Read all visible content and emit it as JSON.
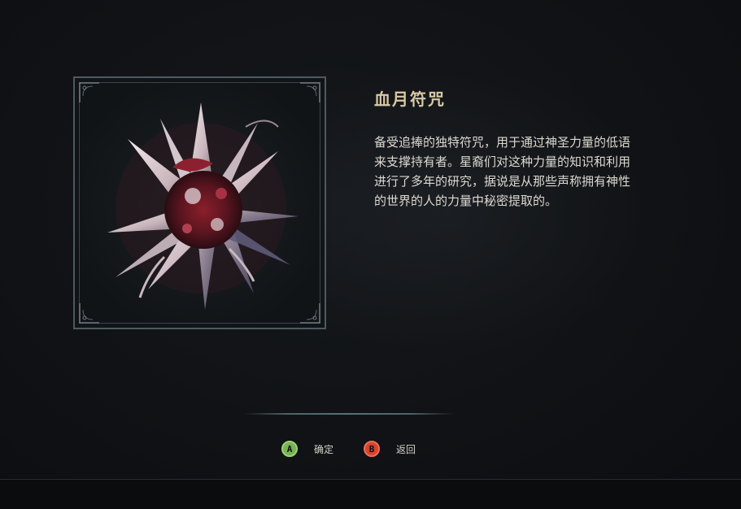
{
  "item": {
    "name": "血月符咒",
    "description_lines": [
      "备受追捧的独特符咒，用于通过神圣力量的低语",
      "来支撑持有者。星裔们对这种力量的知识和利用",
      "进行了多年的研究，据说是从那些声称拥有神性",
      "的世界的人的力量中秘密提取的。"
    ],
    "icon": "blood-moon-charm-icon"
  },
  "prompts": {
    "confirm": {
      "button": "A",
      "label": "确定",
      "color": "#78b254"
    },
    "back": {
      "button": "B",
      "label": "返回",
      "color": "#d4452f"
    }
  },
  "colors": {
    "background": "#0f1114",
    "frame_border": "#4d5a60",
    "title": "#d7c9a4",
    "text": "#dcd9d2"
  }
}
